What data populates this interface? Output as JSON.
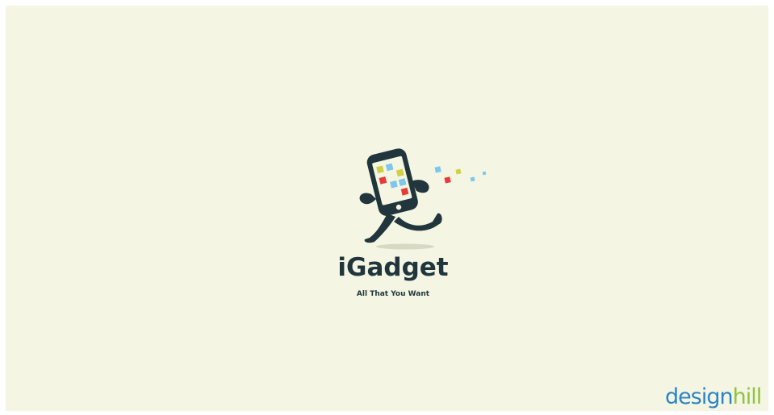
{
  "logo": {
    "wordmark": "iGadget",
    "tagline": "All That You Want",
    "icon": "running-phone-icon",
    "colors": {
      "background": "#f4f6e3",
      "primary": "#21353c",
      "app_yellow": "#d2cf46",
      "app_blue": "#7ec6ea",
      "app_red": "#e53c3a"
    }
  },
  "watermark": {
    "part1": "design",
    "part2": "hill",
    "colors": {
      "part1": "#2c84c6",
      "part2": "#8fc43f"
    }
  }
}
